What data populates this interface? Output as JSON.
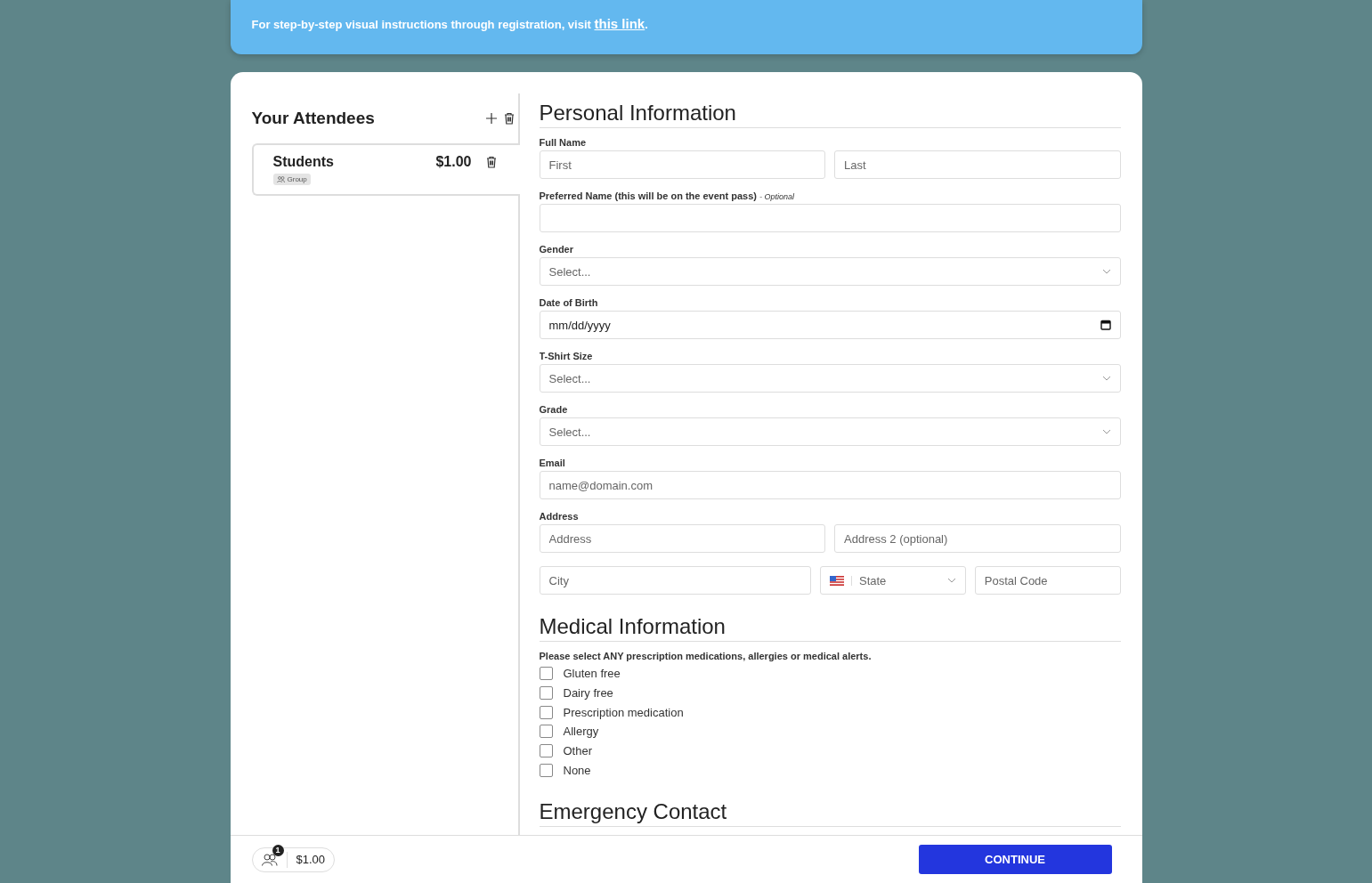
{
  "banner": {
    "text": "For step-by-step visual instructions through registration, visit ",
    "link": "this link",
    "after": "."
  },
  "attendees": {
    "title": "Your Attendees",
    "items": [
      {
        "name": "Students",
        "price": "$1.00",
        "tag": "Group",
        "selected": true
      }
    ]
  },
  "sections": [
    {
      "title": "Personal Information",
      "groups": [
        {
          "label": "Full Name",
          "rows": [
            [
              {
                "kind": "text",
                "placeholder": "First"
              },
              {
                "kind": "text",
                "placeholder": "Last"
              }
            ]
          ]
        },
        {
          "label": "Preferred Name (this will be on the event pass)",
          "note": "- Optional",
          "rows": [
            [
              {
                "kind": "text"
              }
            ]
          ]
        },
        {
          "label": "Gender",
          "rows": [
            [
              {
                "kind": "select",
                "placeholder": "Select..."
              }
            ]
          ]
        },
        {
          "label": "Date of Birth",
          "rows": [
            [
              {
                "kind": "date",
                "value": "mm/dd/yyyy"
              }
            ]
          ]
        },
        {
          "label": "T-Shirt Size",
          "rows": [
            [
              {
                "kind": "select",
                "placeholder": "Select..."
              }
            ]
          ]
        },
        {
          "label": "Grade",
          "rows": [
            [
              {
                "kind": "select",
                "placeholder": "Select..."
              }
            ]
          ]
        },
        {
          "label": "Email",
          "rows": [
            [
              {
                "kind": "text",
                "placeholder": "name@domain.com"
              }
            ]
          ]
        },
        {
          "label": "Address",
          "rows": [
            [
              {
                "kind": "text",
                "placeholder": "Address"
              },
              {
                "kind": "text",
                "placeholder": "Address 2 (optional)"
              }
            ],
            [
              {
                "kind": "text",
                "placeholder": "City"
              },
              {
                "kind": "state",
                "placeholder": "State"
              },
              {
                "kind": "text",
                "placeholder": "Postal Code"
              }
            ]
          ]
        }
      ]
    },
    {
      "title": "Medical Information",
      "groups": [
        {
          "label": "Please select ANY prescription medications, allergies or medical alerts.",
          "checks": [
            {
              "label": "Gluten free",
              "checked": false
            },
            {
              "label": "Dairy free",
              "checked": false
            },
            {
              "label": "Prescription medication",
              "checked": false
            },
            {
              "label": "Allergy",
              "checked": false
            },
            {
              "label": "Other",
              "checked": false
            },
            {
              "label": "None",
              "checked": false
            }
          ]
        }
      ]
    },
    {
      "title": "Emergency Contact"
    }
  ],
  "footer": {
    "count": "1",
    "total": "$1.00",
    "button": "CONTINUE"
  }
}
